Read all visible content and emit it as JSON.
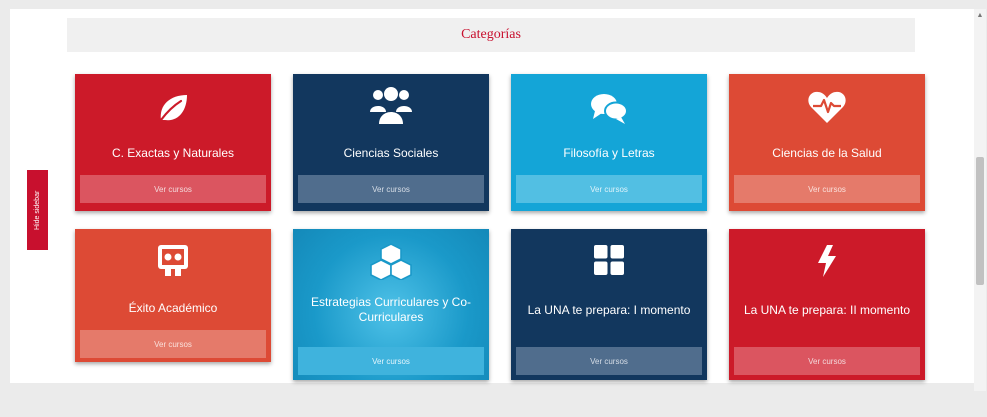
{
  "header": {
    "title": "Categorías"
  },
  "sidebar_toggle": {
    "label": "Hide sidebar"
  },
  "cards": [
    {
      "title": "C. Exactas y Naturales",
      "button": "Ver cursos",
      "icon": "leaf-icon",
      "color": "#cc1a29"
    },
    {
      "title": "Ciencias Sociales",
      "button": "Ver cursos",
      "icon": "users-group-icon",
      "color": "#12375e"
    },
    {
      "title": "Filosofía y Letras",
      "button": "Ver cursos",
      "icon": "chat-bubbles-icon",
      "color": "#14a5d7"
    },
    {
      "title": "Ciencias de la Salud",
      "button": "Ver cursos",
      "icon": "heartbeat-icon",
      "color": "#dd4a35"
    },
    {
      "title": "Éxito Académico",
      "button": "Ver cursos",
      "icon": "presentation-board-icon",
      "color": "#dd4a35"
    },
    {
      "title": "Estrategias Curriculares y Co-Curriculares",
      "button": "Ver cursos",
      "icon": "cubes-icon",
      "color": "#1a99c9"
    },
    {
      "title": "La UNA te prepara: I momento",
      "button": "Ver cursos",
      "icon": "grid-squares-icon",
      "color": "#12375e"
    },
    {
      "title": "La UNA te prepara: II momento",
      "button": "Ver cursos",
      "icon": "lightning-bolt-icon",
      "color": "#cc1a29"
    }
  ]
}
